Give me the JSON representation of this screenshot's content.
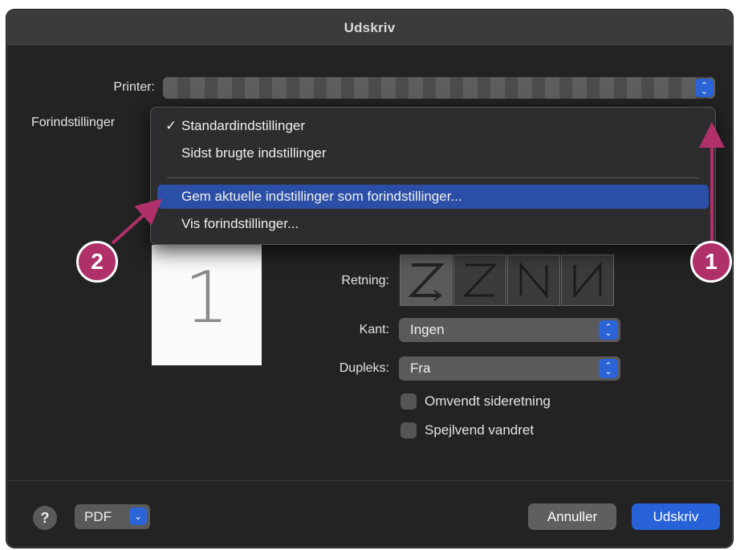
{
  "window": {
    "title": "Udskriv"
  },
  "printer": {
    "label": "Printer:",
    "value": ""
  },
  "presets": {
    "label": "Forindstillinger",
    "menu": [
      {
        "label": "Standardindstillinger",
        "checked": true
      },
      {
        "label": "Sidst brugte indstillinger",
        "checked": false
      },
      {
        "label": "Gem aktuelle indstillinger som forindstillinger...",
        "highlighted": true
      },
      {
        "label": "Vis forindstillinger...",
        "highlighted": false
      }
    ]
  },
  "preview": {
    "page_number": "1"
  },
  "orientation": {
    "label": "Retning:",
    "options": [
      "Z",
      "Z-reversed",
      "N",
      "N-reversed"
    ],
    "selected_index": 0
  },
  "border": {
    "label": "Kant:",
    "value": "Ingen"
  },
  "duplex": {
    "label": "Dupleks:",
    "value": "Fra"
  },
  "checkboxes": [
    {
      "label": "Omvendt sideretning",
      "checked": false
    },
    {
      "label": "Spejlvend vandret",
      "checked": false
    }
  ],
  "footer": {
    "help_label": "?",
    "pdf_label": "PDF",
    "cancel_label": "Annuller",
    "print_label": "Udskriv"
  },
  "annotations": [
    {
      "label": "1",
      "color": "#b0306a"
    },
    {
      "label": "2",
      "color": "#b0306a"
    }
  ],
  "colors": {
    "accent": "#2b64d6",
    "highlight": "#2b4fa6",
    "annotation": "#b0306a"
  }
}
